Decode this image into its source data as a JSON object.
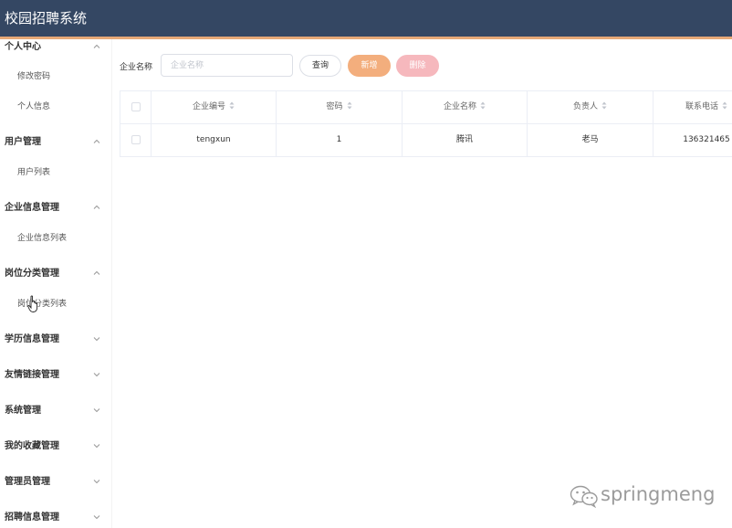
{
  "app": {
    "title": "校园招聘系统"
  },
  "sidebar": {
    "groups": [
      {
        "label": "个人中心",
        "expanded": true,
        "items": [
          "修改密码",
          "个人信息"
        ]
      },
      {
        "label": "用户管理",
        "expanded": true,
        "items": [
          "用户列表"
        ]
      },
      {
        "label": "企业信息管理",
        "expanded": true,
        "items": [
          "企业信息列表"
        ]
      },
      {
        "label": "岗位分类管理",
        "expanded": true,
        "items": [
          "岗位分类列表"
        ]
      },
      {
        "label": "学历信息管理",
        "expanded": false,
        "items": []
      },
      {
        "label": "友情链接管理",
        "expanded": false,
        "items": []
      },
      {
        "label": "系统管理",
        "expanded": false,
        "items": []
      },
      {
        "label": "我的收藏管理",
        "expanded": false,
        "items": []
      },
      {
        "label": "管理员管理",
        "expanded": false,
        "items": []
      },
      {
        "label": "招聘信息管理",
        "expanded": false,
        "items": []
      }
    ]
  },
  "filter": {
    "label": "企业名称",
    "placeholder": "企业名称",
    "value": ""
  },
  "buttons": {
    "query": "查询",
    "add": "新增",
    "delete": "删除"
  },
  "table": {
    "columns": [
      "企业编号",
      "密码",
      "企业名称",
      "负责人",
      "联系电话"
    ],
    "rows": [
      {
        "cells": [
          "tengxun",
          "1",
          "腾讯",
          "老马",
          "136321465"
        ]
      }
    ]
  },
  "watermark": {
    "text": "springmeng"
  },
  "colors": {
    "topbar": "#344763",
    "accent_line": "#e7a978",
    "add_button": "#f3ae7d",
    "delete_button": "#f6b8bd"
  }
}
